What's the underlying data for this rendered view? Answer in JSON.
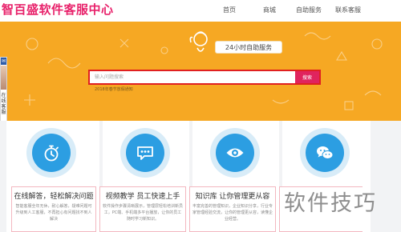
{
  "header": {
    "logo": "智百盛软件客服中心",
    "nav": [
      "首页",
      "商城",
      "自助服务",
      "联系客服"
    ]
  },
  "banner": {
    "service_tag": "24小时自助服务",
    "search": {
      "placeholder": "输入问题搜索",
      "button": "搜索"
    },
    "hint": "2018年春节放假通知",
    "colors": {
      "background": "#f6a823",
      "accent": "#e0245e"
    }
  },
  "side_widget": {
    "icon": "chat-icon",
    "text": "在线客服"
  },
  "cards": [
    {
      "title": "在线解答，轻松解决问题",
      "desc": "智能客服全年无休，耐心解答，疑难问题可升级到人工客服，不再担心有问题找不到人解决",
      "icon": "stopwatch-icon"
    },
    {
      "title": "视频教学 员工快速上手",
      "desc": "软件操作步骤清晰展示，管理层轻松培训新员工，PC端、手机端多平台播放，让你的员工随时学习新知识。",
      "icon": "chat-bubble-icon"
    },
    {
      "title": "知识库 让你管理更从容",
      "desc": "丰富完善的管理知识，企业知识分享，行业专家管理经验交流，让你的管理更从容，读懂企业经营。",
      "icon": "eye-icon"
    },
    {
      "title": "",
      "desc": "",
      "icon": "wechat-icon"
    }
  ],
  "watermark": "软件技巧"
}
